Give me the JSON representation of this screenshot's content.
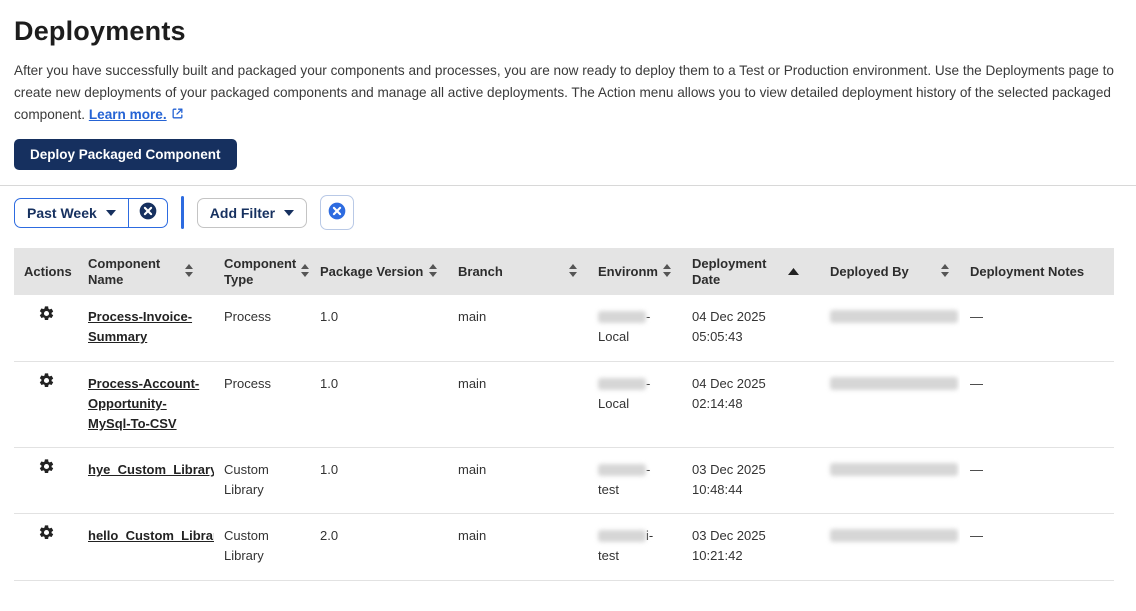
{
  "page": {
    "title": "Deployments",
    "description": "After you have successfully built and packaged your components and processes, you are now ready to deploy them to a Test or Production environment. Use the Deployments page to create new deployments of your packaged components and manage all active deployments. The Action menu allows you to view detailed deployment history of the selected packaged component.",
    "learn_more_label": "Learn more."
  },
  "colors": {
    "navy": "#16305f",
    "blue": "#2d6be0",
    "link_blue": "#2563d4",
    "header_bg": "#e4e4e4"
  },
  "toolbar": {
    "deploy_button_label": "Deploy Packaged Component"
  },
  "filters": {
    "date_filter": {
      "label": "Past Week",
      "clear_icon": "x-circle-icon"
    },
    "add_filter": {
      "label": "Add Filter"
    },
    "clear_all_icon": "x-circle-icon"
  },
  "table": {
    "columns": [
      {
        "label": "Actions",
        "sortable": false
      },
      {
        "label": "Component Name",
        "sortable": true
      },
      {
        "label": "Component Type",
        "sortable": true
      },
      {
        "label": "Package Version",
        "sortable": true
      },
      {
        "label": "Branch",
        "sortable": true
      },
      {
        "label": "Environment",
        "sortable": true
      },
      {
        "label": "Deployment Date",
        "sortable": true,
        "sorted": "asc"
      },
      {
        "label": "Deployed By",
        "sortable": true
      },
      {
        "label": "Deployment Notes",
        "sortable": false
      }
    ],
    "rows": [
      {
        "component_name": "Process-Invoice-Summary",
        "component_type": "Process",
        "package_version": "1.0",
        "branch": "main",
        "environment_redacted": true,
        "environment_suffix": "-Local",
        "environment_line2": "",
        "deployment_date": "04 Dec 2025",
        "deployment_time": "05:05:43",
        "deployed_by_redacted": true,
        "deployment_notes": "—"
      },
      {
        "component_name": "Process-Account-Opportunity-MySql-To-CSV",
        "component_type": "Process",
        "package_version": "1.0",
        "branch": "main",
        "environment_redacted": true,
        "environment_suffix": "-Local",
        "environment_line2": "",
        "deployment_date": "04 Dec 2025",
        "deployment_time": "02:14:48",
        "deployed_by_redacted": true,
        "deployment_notes": "—"
      },
      {
        "component_name": "hye_Custom_Library",
        "component_type": "Custom Library",
        "package_version": "1.0",
        "branch": "main",
        "environment_redacted": true,
        "environment_suffix": "-",
        "environment_line2": "test",
        "deployment_date": "03 Dec 2025",
        "deployment_time": "10:48:44",
        "deployed_by_redacted": true,
        "deployment_notes": "—"
      },
      {
        "component_name": "hello_Custom_Library",
        "component_type": "Custom Library",
        "package_version": "2.0",
        "branch": "main",
        "environment_redacted": true,
        "environment_suffix": "i-",
        "environment_line2": "test",
        "deployment_date": "03 Dec 2025",
        "deployment_time": "10:21:42",
        "deployed_by_redacted": true,
        "deployment_notes": "—"
      }
    ]
  }
}
